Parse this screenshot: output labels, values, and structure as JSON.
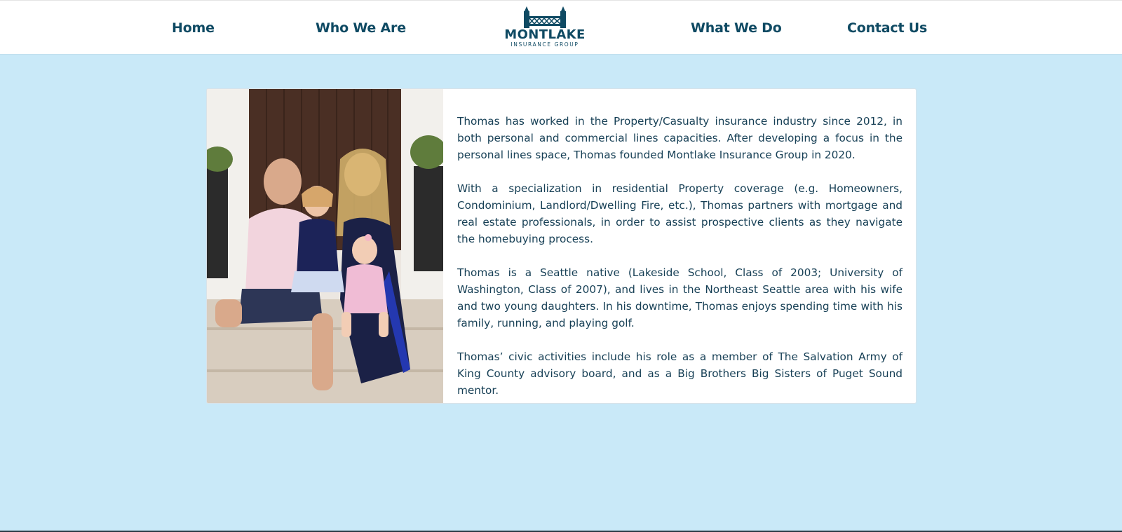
{
  "nav": {
    "home": "Home",
    "who_we_are": "Who We Are",
    "what_we_do": "What We Do",
    "contact_us": "Contact Us"
  },
  "logo": {
    "name": "MONTLAKE",
    "tagline": "INSURANCE GROUP",
    "icon": "bridge-icon"
  },
  "bio": {
    "paragraphs": [
      "Thomas has worked in the Property/Casualty insurance industry since 2012, in both personal and commercial lines capacities. After developing a focus in the personal lines space, Thomas founded Montlake Insurance Group in 2020.",
      "With a specialization in residential Property coverage (e.g. Homeowners, Condominium, Landlord/Dwelling Fire, etc.), Thomas partners with mortgage and real estate professionals, in order to assist prospective clients as they navigate the homebuying process.",
      "Thomas is a Seattle native (Lakeside School, Class of 2003; University of Washington, Class of 2007), and lives in the Northeast Seattle area with his wife and two young daughters. In his downtime, Thomas enjoys spending time with his family, running, and playing golf.",
      "Thomas’ civic activities include his role as a member of The Salvation Army of King County advisory board, and as a Big Brothers Big Sisters of Puget Sound mentor."
    ]
  },
  "colors": {
    "page_background": "#c9e9f8",
    "brand_navy": "#0f4a63",
    "body_text": "#163f55",
    "card_background": "#ffffff"
  }
}
